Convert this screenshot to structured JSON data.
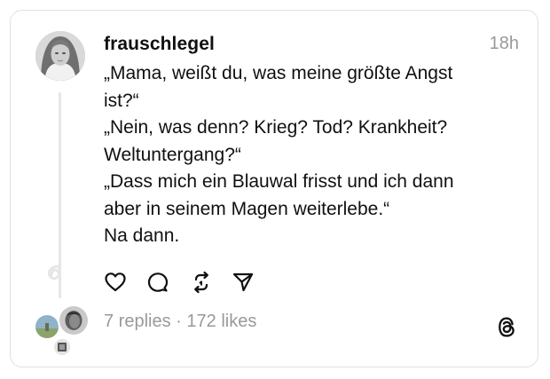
{
  "post": {
    "username": "frauschlegel",
    "time": "18h",
    "lines": [
      "„Mama, weißt du, was meine größte Angst",
      "ist?“",
      "„Nein, was denn? Krieg? Tod? Krankheit?",
      "Weltuntergang?“",
      "„Dass mich ein Blauwal frisst und ich dann",
      "aber in seinem Magen weiterlebe.“",
      "Na dann."
    ]
  },
  "actions": {
    "icons": [
      "heart-icon",
      "comment-icon",
      "repost-icon",
      "share-icon"
    ]
  },
  "stats": {
    "replies": "7 replies",
    "separator": " · ",
    "likes": "172 likes"
  },
  "brand": {
    "logo_icon": "threads-logo-icon"
  }
}
